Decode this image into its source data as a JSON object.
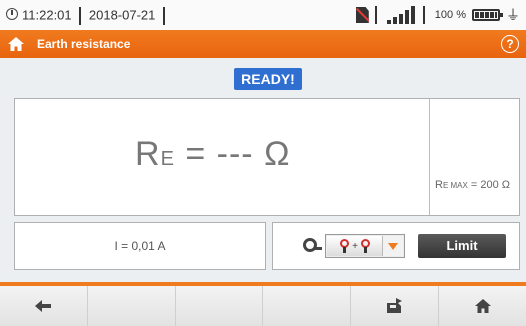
{
  "status_bar": {
    "time": "11:22:01",
    "date": "2018-07-21",
    "battery_percent": "100 %",
    "signal_bars": 5,
    "icons": [
      "clock-icon",
      "sd-card-disabled-icon",
      "signal-icon",
      "battery-icon",
      "plug-icon"
    ]
  },
  "header": {
    "title": "Earth resistance",
    "home_icon": "home-icon",
    "help_icon": "help-icon",
    "color": "#f07a1e"
  },
  "status": {
    "badge": "READY!",
    "color": "#2f6fd1"
  },
  "measurement": {
    "symbol": "R",
    "symbol_sub": "E",
    "equals": " = ",
    "value": "---",
    "unit": " Ω",
    "limit_symbol": "R",
    "limit_sub": "E MAX",
    "limit_value": " = 200 Ω"
  },
  "current": {
    "text": "I = 0,01 A"
  },
  "controls": {
    "method_icon": "clamp-method-icon",
    "method_label": "+",
    "settings_icon": "gear-icon",
    "limit_label": "Limit"
  },
  "bottom_bar": {
    "buttons": [
      "back-icon",
      "",
      "",
      "",
      "save-icon",
      "home-icon"
    ]
  }
}
